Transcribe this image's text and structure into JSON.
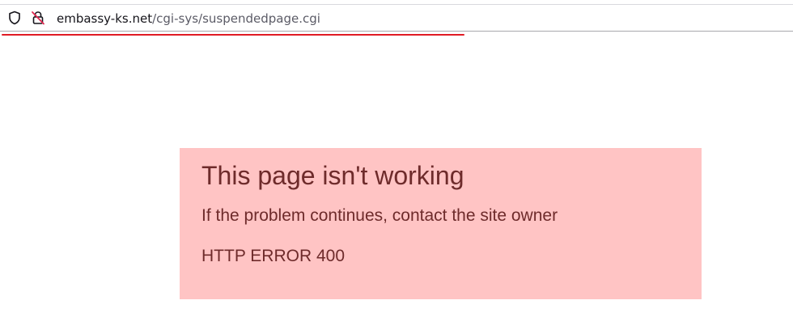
{
  "browser": {
    "url_domain": "embassy-ks.net",
    "url_path": "/cgi-sys/suspendedpage.cgi",
    "icons": [
      "shield-icon",
      "insecure-lock-icon"
    ],
    "load_indicator_color": "#e01b24"
  },
  "error": {
    "title": "This page isn't working",
    "message": "If the problem continues, contact the site owner",
    "code": "HTTP ERROR 400",
    "background_color": "#ffc4c4",
    "text_color": "#6e2b2b"
  }
}
